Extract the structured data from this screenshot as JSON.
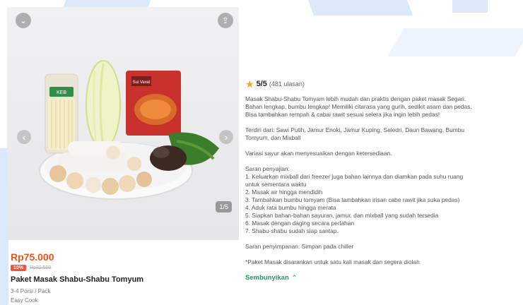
{
  "gallery": {
    "counter": "1/5",
    "icons": {
      "collapse": "chevron-down-icon",
      "share": "share-icon",
      "prev": "chevron-left-icon",
      "next": "chevron-right-icon"
    },
    "package_labels": {
      "noodle": "KEB",
      "mix": "Sui Vexel"
    }
  },
  "product": {
    "price": "Rp75.000",
    "discount": "10%",
    "original_price": "Rp82.500",
    "name": "Paket Masak Shabu-Shabu Tomyum",
    "portion": "3-4 Porsi / Pack",
    "cook_level": "Easy Cook"
  },
  "rating": {
    "score": "5/5",
    "count": "(481 ulasan)",
    "star_color": "#f5a623"
  },
  "description": {
    "intro": [
      "Masak Shabu-Shabu Tomyam lebih mudah dan praktis dengan paket masak Segari.",
      "Bahan lengkap, bumbu lengkap! Memiliki citarasa yang gurih, sedikit asam dan pedas.",
      "Bisa tambahkan rempah & cabai rawit sesuai selera jika ingin lebih pedas!"
    ],
    "contents": [
      "Terdiri dari: Sawi Putih, Jamur Enoki, Jamur Kuping, Seledri, Daun Bawang, Bumbu",
      "Tomyum, dan Mixball"
    ],
    "variation": "Variasi sayur akan menyesuaikan dengan ketersediaan.",
    "serving_title": "Saran penyajian:",
    "serving_steps": [
      "1. Keluarkan mixball dari freezer juga bahan lainnya dan diamkan pada suhu ruang",
      "untuk sementara waktu",
      "2. Masak air hingga mendidih",
      "3. Tambahkan bumbu tomyam (Bisa tambahkan irisan cabe rawit jika suka pedas)",
      "4. Aduk rata bumbu hingga merata",
      "5. Siapkan bahan-bahan sayuran, jamur, dan mixball yang sudah tersedia",
      "6. Masak dengan daging secara perlahan",
      "7. Shabu-shabu sudah siap santap."
    ],
    "storage": "Saran penyimpanan: Simpan pada chiller",
    "note": "*Paket Masak disarankan untuk satu kali masak dan segera diolah",
    "hide_label": "Sembunyikan",
    "hide_icon": "chevron-up-icon"
  },
  "colors": {
    "price": "#e8541e",
    "discount_badge": "#f0553c",
    "link": "#1a9e5b",
    "background_decoration": "#dce9fb"
  }
}
